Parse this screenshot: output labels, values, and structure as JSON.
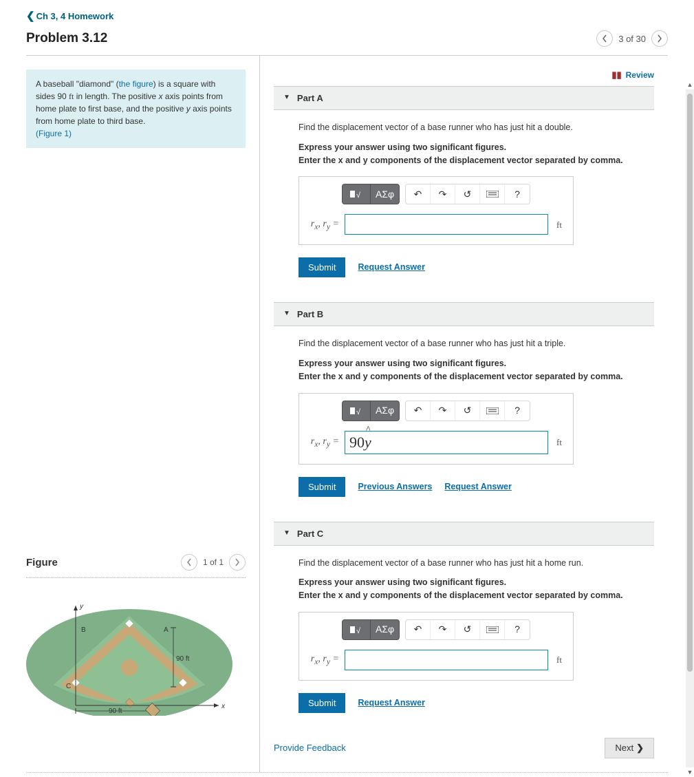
{
  "nav": {
    "back_label": "Ch 3, 4 Homework"
  },
  "header": {
    "title": "Problem 3.12",
    "pager": "3 of 30"
  },
  "description": {
    "line1_pre": "A baseball \"diamond\" (",
    "line1_link": "the figure",
    "line1_post": ") is a square with sides 90 ",
    "unit": "ft",
    "line2": " in length. The positive ",
    "x": "x",
    "line3": " axis points from home plate to first base, and the positive ",
    "y": "y",
    "line4": " axis points from home plate to third base.",
    "fig_ref": "(Figure 1)"
  },
  "figure": {
    "heading": "Figure",
    "pager": "1 of 1",
    "label_A": "A",
    "label_B": "B",
    "label_C": "C",
    "label_90a": "90 ft",
    "label_90b": "90 ft",
    "axis_x": "x",
    "axis_y": "y"
  },
  "review_label": "Review",
  "parts": [
    {
      "label": "Part A",
      "prompt": "Find the displacement vector of a base runner who has just hit a double.",
      "instr1": "Express your answer using two significant figures.",
      "instr2": "Enter the x and y components of the displacement vector separated by comma.",
      "var": "rₓ, r_y =",
      "value": "",
      "unit": "ft",
      "links": [
        "Request Answer"
      ]
    },
    {
      "label": "Part B",
      "prompt": "Find the displacement vector of a base runner who has just hit a triple.",
      "instr1": "Express your answer using two significant figures.",
      "instr2": "Enter the x and y components of the displacement vector separated by comma.",
      "var": "rₓ, r_y =",
      "value": "90ŷ",
      "unit": "ft",
      "links": [
        "Previous Answers",
        "Request Answer"
      ]
    },
    {
      "label": "Part C",
      "prompt": "Find the displacement vector of a base runner who has just hit a home run.",
      "instr1": "Express your answer using two significant figures.",
      "instr2": "Enter the x and y components of the displacement vector separated by comma.",
      "var": "rₓ, r_y =",
      "value": "",
      "unit": "ft",
      "links": [
        "Request Answer"
      ]
    }
  ],
  "toolbar": {
    "greek": "ΑΣφ",
    "help": "?"
  },
  "submit_label": "Submit",
  "feedback_label": "Provide Feedback",
  "next_label": "Next"
}
